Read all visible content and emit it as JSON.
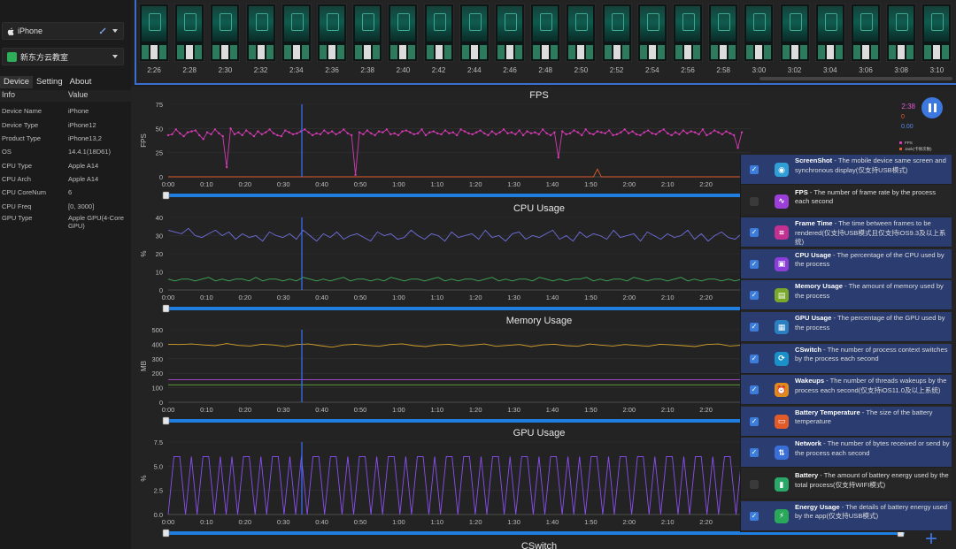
{
  "sidebar": {
    "device_dropdown": "iPhone",
    "app_dropdown": "新东方云教室",
    "tabs": [
      "Device",
      "Setting",
      "About"
    ],
    "info_header": [
      "Info",
      "Value"
    ],
    "info_rows": [
      [
        "Device Name",
        "iPhone"
      ],
      [
        "Device Type",
        "iPhone12"
      ],
      [
        "Product Type",
        "iPhone13,2"
      ],
      [
        "OS",
        "14.4.1(18D61)"
      ],
      [
        "CPU Type",
        "Apple A14"
      ],
      [
        "CPU Arch",
        "Apple A14"
      ],
      [
        "CPU CoreNum",
        "6"
      ],
      [
        "CPU Freq",
        "[0, 3000]"
      ],
      [
        "GPU Type",
        "Apple GPU(4-Core GPU)"
      ]
    ]
  },
  "strip": {
    "labels": [
      "2:26",
      "2:28",
      "2:30",
      "2:32",
      "2:34",
      "2:36",
      "2:38",
      "2:40",
      "2:42",
      "2:44",
      "2:46",
      "2:48",
      "2:50",
      "2:52",
      "2:54",
      "2:56",
      "2:58",
      "3:00",
      "3:02",
      "3:04",
      "3:06",
      "3:08",
      "3:10"
    ]
  },
  "charts": {
    "x_ticks": [
      "0:00",
      "0:10",
      "0:20",
      "0:30",
      "0:40",
      "0:50",
      "1:00",
      "1:10",
      "1:20",
      "1:30",
      "1:40",
      "1:50",
      "2:00",
      "2:10",
      "2:20"
    ],
    "fps": {
      "title": "FPS",
      "ylabel": "FPS",
      "yticks": [
        "75",
        "50",
        "25",
        "0"
      ],
      "readout": [
        "2:38",
        "0",
        "0.00"
      ],
      "legend": [
        "FPS",
        "Jank(卡顿次数)"
      ]
    },
    "cpu": {
      "title": "CPU Usage",
      "ylabel": "%",
      "yticks": [
        "40",
        "30",
        "20",
        "10",
        "0"
      ]
    },
    "memory": {
      "title": "Memory Usage",
      "ylabel": "MB",
      "yticks": [
        "500",
        "400",
        "300",
        "200",
        "100",
        "0"
      ]
    },
    "gpu": {
      "title": "GPU Usage",
      "ylabel": "%",
      "yticks": [
        "7.5",
        "5.0",
        "2.5",
        "0.0"
      ]
    },
    "next_title": "CSwitch"
  },
  "chart_data": [
    {
      "type": "line",
      "title": "FPS",
      "ylabel": "FPS",
      "ylim": [
        0,
        75
      ],
      "x_range": [
        "0:00",
        "2:28"
      ],
      "series": [
        {
          "name": "FPS",
          "values": [
            43,
            44,
            49,
            45,
            42,
            46,
            47,
            48,
            43,
            39,
            46,
            44,
            49,
            45,
            42,
            10,
            50,
            44,
            46,
            43,
            48,
            45,
            42,
            47,
            44,
            46,
            49,
            45,
            43,
            42,
            48,
            46,
            44,
            45,
            47,
            49,
            46,
            43,
            45,
            44,
            48,
            45,
            47,
            44,
            46,
            49,
            45,
            43,
            2,
            46,
            44,
            48,
            45,
            43,
            47,
            46,
            49,
            44,
            45,
            43,
            47,
            48,
            46,
            44,
            45,
            49,
            43,
            46,
            47,
            45,
            44,
            48,
            45,
            46,
            43,
            49,
            47,
            45,
            44,
            46,
            48,
            45,
            43,
            47,
            44,
            46,
            49,
            45,
            46,
            44,
            48,
            43,
            47,
            45,
            46,
            44,
            49,
            45,
            43,
            46,
            20,
            47,
            44,
            45,
            48,
            46,
            43,
            49,
            45,
            44,
            47,
            46,
            45,
            48,
            43,
            44,
            46,
            49,
            45,
            47,
            44,
            43,
            46,
            48,
            45,
            44,
            47,
            49,
            45,
            43,
            46,
            44,
            48,
            45,
            47,
            46,
            44,
            49,
            43,
            45,
            48,
            46,
            44,
            47,
            45,
            43,
            30,
            46
          ]
        },
        {
          "name": "Jank(卡顿次数)",
          "values": [
            0,
            0,
            0,
            0,
            0,
            0,
            0,
            0,
            0,
            0,
            0,
            0,
            0,
            0,
            0,
            0,
            0,
            0,
            0,
            0,
            0,
            0,
            0,
            0,
            0,
            0,
            0,
            0,
            0,
            0,
            0,
            0,
            0,
            0,
            0,
            0,
            0,
            0,
            0,
            0,
            0,
            0,
            0,
            0,
            0,
            0,
            0,
            0,
            0,
            0,
            0,
            0,
            0,
            0,
            0,
            0,
            0,
            0,
            0,
            0,
            0,
            0,
            0,
            0,
            0,
            0,
            0,
            0,
            0,
            0,
            0,
            0,
            0,
            0,
            0,
            0,
            0,
            0,
            0,
            0,
            0,
            0,
            0,
            0,
            0,
            0,
            0,
            0,
            0,
            0,
            0,
            0,
            0,
            0,
            0,
            0,
            0,
            0,
            0,
            0,
            0,
            0,
            0,
            0,
            0,
            0,
            0,
            0,
            0,
            0,
            8,
            0,
            0,
            0,
            0,
            0,
            0,
            0,
            0,
            0,
            0,
            0,
            0,
            0,
            0,
            0,
            0,
            0,
            0,
            0,
            0,
            0,
            0,
            0,
            0,
            0,
            0,
            0,
            0,
            0,
            0,
            0,
            0,
            0,
            0,
            0,
            0,
            0
          ]
        }
      ]
    },
    {
      "type": "line",
      "title": "CPU Usage",
      "ylabel": "%",
      "ylim": [
        0,
        40
      ],
      "series": [
        {
          "name": "",
          "values": [
            33,
            32,
            31,
            34,
            30,
            29,
            31,
            33,
            30,
            32,
            28,
            31,
            29,
            30,
            27,
            32,
            30,
            29,
            31,
            28,
            33,
            30,
            27,
            31,
            29,
            32,
            28,
            30,
            31,
            29,
            27,
            32,
            30,
            31,
            28,
            29,
            33,
            30,
            28,
            31,
            30,
            27,
            32,
            29,
            30,
            31,
            28,
            33,
            29,
            30,
            27,
            31,
            32,
            28,
            30,
            29,
            31,
            33,
            28,
            30,
            27,
            32,
            29,
            31,
            30,
            28,
            33,
            29,
            30,
            31,
            27,
            32,
            30,
            28,
            31,
            29,
            30,
            33,
            28,
            31,
            27,
            30,
            32,
            29,
            28,
            31
          ]
        },
        {
          "name": "",
          "values": [
            6,
            5,
            6,
            6,
            5,
            6,
            7,
            5,
            6,
            5,
            6,
            6,
            5,
            7,
            5,
            6,
            6,
            5,
            6,
            5,
            7,
            6,
            5,
            6,
            5,
            6,
            7,
            5,
            6,
            6,
            5,
            6,
            5,
            7,
            6,
            5,
            6,
            6,
            5,
            6,
            7,
            5,
            6,
            5,
            6,
            6,
            5,
            6,
            7,
            5,
            6,
            5,
            6,
            6,
            5,
            7,
            6,
            5,
            6,
            5,
            6,
            6,
            7,
            5,
            6,
            5,
            6,
            6,
            5,
            7,
            6,
            5,
            6,
            6,
            5,
            6,
            7,
            5,
            6,
            5,
            6,
            6,
            5,
            6,
            5,
            6
          ]
        }
      ]
    },
    {
      "type": "line",
      "title": "Memory Usage",
      "ylabel": "MB",
      "ylim": [
        0,
        500
      ],
      "series": [
        {
          "name": "",
          "values": [
            400,
            398,
            402,
            395,
            390,
            405,
            392,
            388,
            400,
            395,
            385,
            398,
            402,
            390,
            380,
            395,
            400,
            392,
            386,
            398,
            403,
            390,
            384,
            396,
            400,
            388,
            394,
            402,
            386,
            392,
            398,
            384,
            396,
            400,
            390,
            386,
            402,
            394,
            388,
            398,
            392,
            386,
            400,
            396,
            390,
            384,
            398,
            402,
            388,
            394
          ]
        },
        {
          "name": "",
          "values": [
            155,
            155,
            155,
            155,
            155,
            155,
            155,
            155,
            155,
            155,
            155,
            155,
            155,
            155,
            155,
            155,
            155,
            155,
            155,
            155,
            155,
            155,
            155,
            155,
            155,
            155,
            155,
            155,
            155,
            155,
            155,
            155,
            155,
            155,
            155,
            155,
            155,
            155,
            155,
            155,
            155,
            155,
            155,
            155,
            155,
            155,
            155,
            155,
            155,
            155
          ]
        },
        {
          "name": "",
          "values": [
            120,
            120,
            120,
            120,
            120,
            120,
            120,
            120,
            120,
            120,
            120,
            120,
            120,
            120,
            120,
            120,
            120,
            120,
            120,
            120,
            120,
            120,
            120,
            120,
            120,
            120,
            120,
            120,
            120,
            120,
            120,
            120,
            120,
            120,
            120,
            120,
            120,
            120,
            120,
            120,
            120,
            120,
            120,
            120,
            120,
            120,
            120,
            120,
            120,
            120
          ]
        }
      ]
    },
    {
      "type": "line",
      "title": "GPU Usage",
      "ylabel": "%",
      "ylim": [
        0,
        7.5
      ],
      "series": [
        {
          "name": "",
          "values": [
            0,
            6,
            6,
            0,
            6,
            0,
            6,
            6,
            0,
            6,
            0,
            6,
            0,
            6,
            6,
            0,
            6,
            0,
            6,
            6,
            0,
            6,
            0,
            6,
            0,
            6,
            6,
            0,
            6,
            6,
            0,
            6,
            0,
            6,
            6,
            0,
            6,
            0,
            6,
            6,
            0,
            6,
            0,
            6,
            6,
            0,
            6,
            0,
            6,
            6,
            0,
            6,
            6,
            0,
            6,
            0,
            6,
            6,
            0,
            6,
            0,
            6,
            6,
            0,
            6,
            0,
            6,
            6,
            0,
            6,
            0,
            6,
            0,
            6,
            6,
            0,
            6,
            0,
            6,
            6,
            0,
            6,
            6,
            0,
            6,
            0,
            6,
            6,
            0,
            6,
            0,
            6,
            6,
            0,
            6,
            0,
            6,
            6,
            0,
            6
          ]
        }
      ]
    }
  ],
  "metrics": [
    {
      "name": "ScreenShot",
      "desc": " - The mobile device same screen and synchronous display(仅支持USB模式)",
      "checked": true,
      "enabled": true,
      "color": "#2f9fd6",
      "icon": "camera-icon",
      "sym": "◉"
    },
    {
      "name": "FPS",
      "desc": " - The number of frame rate by the process each second",
      "checked": true,
      "enabled": false,
      "color": "#9b3fd8",
      "icon": "pulse-icon",
      "sym": "∿"
    },
    {
      "name": "Frame Time",
      "desc": " - The time between frames to be rendered(仅支持USB模式且仅支持iOS9.3及以上系统)",
      "checked": true,
      "enabled": true,
      "color": "#c2318f",
      "icon": "frame-icon",
      "sym": "⌗"
    },
    {
      "name": "CPU Usage",
      "desc": " - The percentage of the CPU used by the process",
      "checked": true,
      "enabled": true,
      "color": "#8b3fd8",
      "icon": "chip-icon",
      "sym": "▣"
    },
    {
      "name": "Memory Usage",
      "desc": " - The amount of memory used by the process",
      "checked": true,
      "enabled": true,
      "color": "#7aa82a",
      "icon": "memory-icon",
      "sym": "▤"
    },
    {
      "name": "GPU Usage",
      "desc": " - The percentage of the GPU used by the process",
      "checked": true,
      "enabled": true,
      "color": "#2a7fc1",
      "icon": "gpu-icon",
      "sym": "▦"
    },
    {
      "name": "CSwitch",
      "desc": " - The number of process context switches by the process each second",
      "checked": true,
      "enabled": true,
      "color": "#1a8fc8",
      "icon": "switch-icon",
      "sym": "⟳"
    },
    {
      "name": "Wakeups",
      "desc": " - The number of threads wakeups by the process each second(仅支持iOS11.0及以上系统)",
      "checked": true,
      "enabled": true,
      "color": "#e08a1c",
      "icon": "alarm-icon",
      "sym": "⏰"
    },
    {
      "name": "Battery Temperature",
      "desc": " - The size of the battery temperature",
      "checked": true,
      "enabled": true,
      "color": "#e05a2a",
      "icon": "battery-temp-icon",
      "sym": "▭"
    },
    {
      "name": "Network",
      "desc": " - The number of bytes received or send by the process each second",
      "checked": true,
      "enabled": true,
      "color": "#3a6fd8",
      "icon": "network-icon",
      "sym": "⇅"
    },
    {
      "name": "Battery",
      "desc": " - The amount of battery energy used by the total process(仅支持WIFI模式)",
      "checked": false,
      "enabled": true,
      "color": "#2aa86a",
      "icon": "battery-icon",
      "sym": "▮"
    },
    {
      "name": "Energy Usage",
      "desc": " - The details of battery energy used by the app(仅支持USB模式)",
      "checked": true,
      "enabled": true,
      "color": "#2aa85a",
      "icon": "energy-icon",
      "sym": "⚡"
    }
  ],
  "colors": {
    "accent": "#3c78e0",
    "fps_line": "#d63ab4",
    "cpu_line": "#6f6fe0",
    "cpu_line2": "#3fae5a",
    "mem_line": "#d6a12a",
    "mem_line2": "#b04ad8",
    "mem_line3": "#5fae3a",
    "gpu_line": "#8a4ff0",
    "cursor": "#3c6fff"
  }
}
